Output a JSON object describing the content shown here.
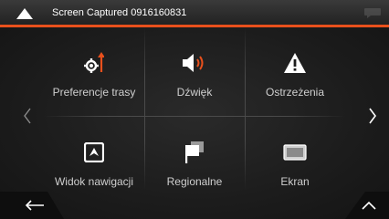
{
  "header": {
    "title": "Screen Captured 0916160831"
  },
  "menu": {
    "items": [
      {
        "label": "Preferencje trasy",
        "icon": "route-preferences-icon"
      },
      {
        "label": "Dźwięk",
        "icon": "speaker-icon"
      },
      {
        "label": "Ostrzeżenia",
        "icon": "warning-icon"
      },
      {
        "label": "Widok nawigacji",
        "icon": "navigation-view-icon"
      },
      {
        "label": "Regionalne",
        "icon": "flags-icon"
      },
      {
        "label": "Ekran",
        "icon": "display-icon"
      }
    ]
  },
  "colors": {
    "accent": "#e8501c",
    "background": "#1a1a1a",
    "text": "#cfcfcf"
  }
}
